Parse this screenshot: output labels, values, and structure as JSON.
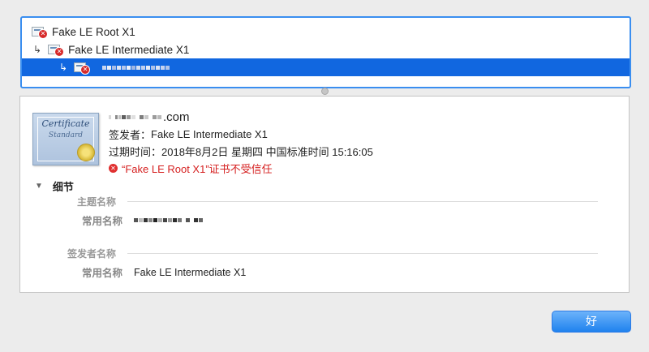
{
  "chain": {
    "items": [
      {
        "name": "Fake LE Root X1",
        "arrow": ""
      },
      {
        "name": "Fake LE Intermediate X1",
        "arrow": "↳"
      },
      {
        "name": "",
        "arrow": "↳"
      }
    ]
  },
  "detail": {
    "domain_suffix": ".com",
    "issuer_label": "签发者：",
    "issuer_value": "Fake LE Intermediate X1",
    "expiry_label": "过期时间：",
    "expiry_value": "2018年8月2日 星期四 中国标准时间 15:16:05",
    "trust_error": "“Fake LE Root X1”证书不受信任",
    "details_section": "细节",
    "subject_group": "主题名称",
    "issuer_group": "签发者名称",
    "common_name_label": "常用名称",
    "issuer_common_name": "Fake LE Intermediate X1",
    "certificate_art_title": "Certificate",
    "certificate_art_subtitle": "Standard"
  },
  "buttons": {
    "ok": "好"
  },
  "colors": {
    "selection": "#1167e0",
    "focus_ring": "#3a8ef0",
    "error": "#d52020",
    "button": "#1f82ee"
  }
}
